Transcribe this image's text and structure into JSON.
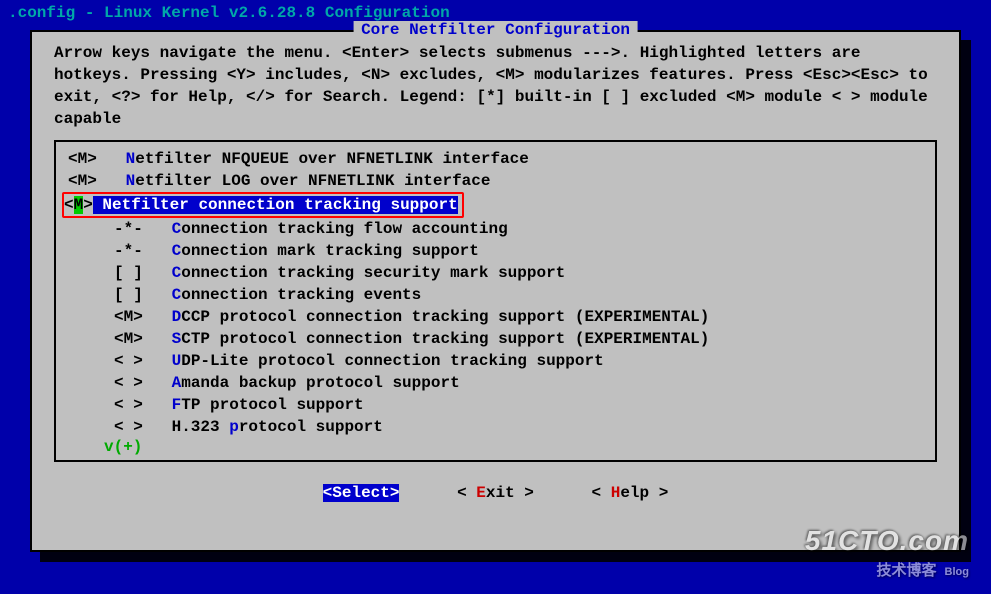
{
  "title": ".config - Linux Kernel v2.6.28.8 Configuration",
  "section_title": "Core Netfilter Configuration",
  "help_text": "Arrow keys navigate the menu.  <Enter> selects submenus --->.  Highlighted letters are hotkeys.  Pressing <Y> includes, <N> excludes, <M> modularizes features.  Press <Esc><Esc> to exit, <?> for Help, </> for Search.  Legend: [*] built-in  [ ] excluded  <M> module  < > module capable",
  "items": [
    {
      "mark": "<M>",
      "indent": false,
      "hotkey": "N",
      "before": "",
      "after": "etfilter NFQUEUE over NFNETLINK interface",
      "selected": false
    },
    {
      "mark": "<M>",
      "indent": false,
      "hotkey": "N",
      "before": "",
      "after": "etfilter LOG over NFNETLINK interface",
      "selected": false
    },
    {
      "mark": "<M>",
      "indent": false,
      "hotkey": "",
      "before": "",
      "after": "Netfilter connection tracking support",
      "selected": true
    },
    {
      "mark": "-*-",
      "indent": true,
      "hotkey": "C",
      "before": "",
      "after": "onnection tracking flow accounting",
      "selected": false
    },
    {
      "mark": "-*-",
      "indent": true,
      "hotkey": "C",
      "before": "",
      "after": "onnection mark tracking support",
      "selected": false
    },
    {
      "mark": "[ ]",
      "indent": true,
      "hotkey": "C",
      "before": "",
      "after": "onnection tracking security mark support",
      "selected": false
    },
    {
      "mark": "[ ]",
      "indent": true,
      "hotkey": "C",
      "before": "",
      "after": "onnection tracking events",
      "selected": false
    },
    {
      "mark": "<M>",
      "indent": true,
      "hotkey": "D",
      "before": "",
      "after": "CCP protocol connection tracking support (EXPERIMENTAL)",
      "selected": false
    },
    {
      "mark": "<M>",
      "indent": true,
      "hotkey": "S",
      "before": "",
      "after": "CTP protocol connection tracking support (EXPERIMENTAL)",
      "selected": false
    },
    {
      "mark": "< >",
      "indent": true,
      "hotkey": "U",
      "before": "",
      "after": "DP-Lite protocol connection tracking support",
      "selected": false
    },
    {
      "mark": "< >",
      "indent": true,
      "hotkey": "A",
      "before": "",
      "after": "manda backup protocol support",
      "selected": false
    },
    {
      "mark": "< >",
      "indent": true,
      "hotkey": "F",
      "before": "",
      "after": "TP protocol support",
      "selected": false
    },
    {
      "mark": "< >",
      "indent": true,
      "hotkey": "p",
      "before": "H.323 ",
      "after": "rotocol support",
      "selected": false
    }
  ],
  "more_indicator": "v(+)",
  "buttons": {
    "select": {
      "label": "Select",
      "selected": true
    },
    "exit": {
      "label": "Exit",
      "selected": false,
      "hotkey": "E"
    },
    "help": {
      "label": "Help",
      "selected": false,
      "hotkey": "H"
    }
  },
  "watermark": {
    "line1": "51CTO.com",
    "line2": "技术博客",
    "sub": "Blog"
  }
}
